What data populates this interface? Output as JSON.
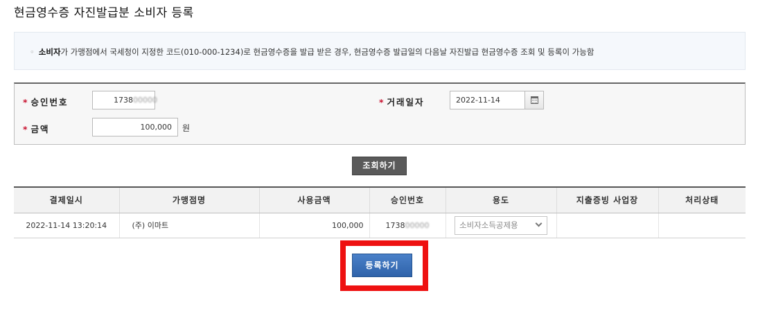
{
  "page": {
    "title": "현금영수증 자진발급분 소비자 등록"
  },
  "notice": {
    "bullet": "◦",
    "strong": "소비자",
    "text": "가 가맹점에서 국세청이 지정한 코드(010-000-1234)로 현금영수증을 발급 받은 경우, 현금영수증 발급일의 다음날 자진발급 현금영수증 조회 및 등록이 가능함"
  },
  "form": {
    "approval_label": "승인번호",
    "approval_value": "1738",
    "approval_masked": "00000",
    "date_label": "거래일자",
    "date_value": "2022-11-14",
    "amount_label": "금액",
    "amount_value": "100,000",
    "amount_unit": "원",
    "required_mark": "*",
    "calendar_icon": "calendar-icon"
  },
  "buttons": {
    "search": "조회하기",
    "register": "등록하기"
  },
  "table": {
    "headers": [
      "결제일시",
      "가맹점명",
      "사용금액",
      "승인번호",
      "용도",
      "지출증빙 사업장",
      "처리상태"
    ],
    "rows": [
      {
        "datetime": "2022-11-14 13:20:14",
        "merchant": "(주) 이마트",
        "amount": "100,000",
        "approval": "1738",
        "approval_masked": "00000",
        "purpose": "소비자소득공제용",
        "business": "",
        "status": ""
      }
    ]
  },
  "colors": {
    "required": "#c8102e",
    "highlight": "#ee1111",
    "primary_button": "#2f63aa",
    "search_button": "#5a5a5a"
  }
}
